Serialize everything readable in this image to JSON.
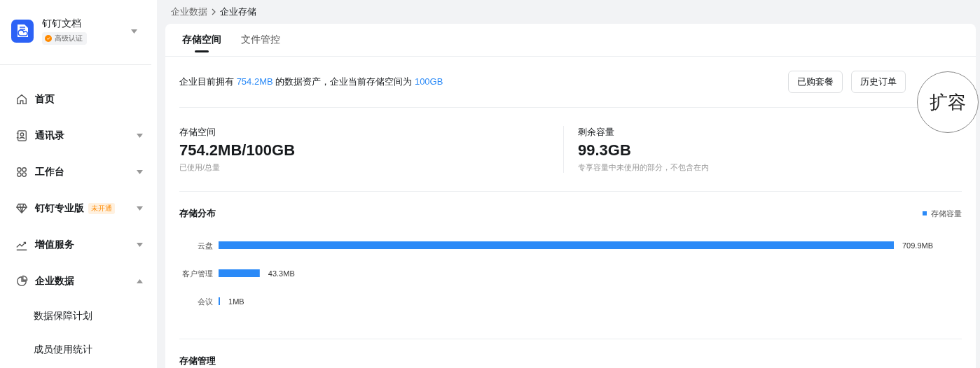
{
  "sidebar": {
    "org": {
      "name": "钉钉文档",
      "badge": "高级认证"
    },
    "items": [
      {
        "kind": "home",
        "label": "首页"
      },
      {
        "kind": "contacts",
        "label": "通讯录",
        "expanded": false
      },
      {
        "kind": "workbench",
        "label": "工作台",
        "expanded": false
      },
      {
        "kind": "pro",
        "label": "钉钉专业版",
        "tag": "未开通",
        "expanded": false
      },
      {
        "kind": "growth",
        "label": "增值服务",
        "expanded": false
      },
      {
        "kind": "data",
        "label": "企业数据",
        "expanded": true,
        "children": [
          {
            "label": "数据保障计划"
          },
          {
            "label": "成员使用统计"
          }
        ]
      }
    ]
  },
  "breadcrumb": [
    "企业数据",
    "企业存储"
  ],
  "tabs": [
    {
      "label": "存储空间",
      "selected": true
    },
    {
      "label": "文件管控",
      "selected": false
    }
  ],
  "summary": [
    {
      "text": "企业目前拥有 ",
      "highlight": false
    },
    {
      "text": "754.2MB",
      "highlight": true
    },
    {
      "text": " 的数据资产，企业当前存储空间为 ",
      "highlight": false
    },
    {
      "text": "100GB",
      "highlight": true
    }
  ],
  "buttons": [
    "已购套餐",
    "历史订单"
  ],
  "magnified_button": "扩容",
  "stats": [
    {
      "label": "存储空间",
      "value": "754.2MB/100GB",
      "note": "已使用/总量"
    },
    {
      "label": "剩余容量",
      "value": "99.3GB",
      "note": "专享容量中未使用的部分，不包含在内"
    }
  ],
  "distribution": {
    "title": "存储分布",
    "chart_data": {
      "type": "bar",
      "orientation": "horizontal",
      "categories": [
        "云盘",
        "客户管理",
        "会议"
      ],
      "series": [
        {
          "name": "存储容量",
          "color": "#2b8af7",
          "values": [
            709.9,
            43.3,
            1
          ]
        }
      ],
      "data_labels": true,
      "value_labels": [
        "709.9MB",
        "43.3MB",
        "1MB"
      ]
    }
  },
  "management": {
    "title": "存储管理"
  }
}
